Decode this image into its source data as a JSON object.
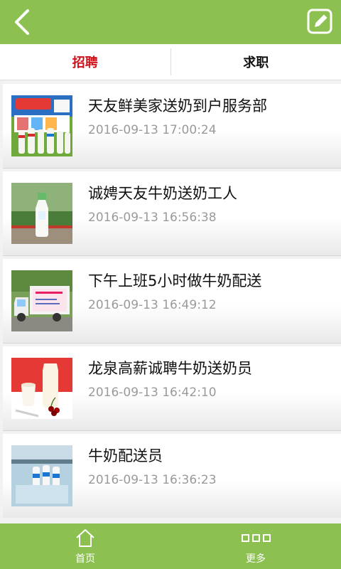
{
  "tabs": [
    {
      "label": "招聘"
    },
    {
      "label": "求职"
    }
  ],
  "items": [
    {
      "title": "天友鲜美家送奶到户服务部",
      "time": "2016-09-13 17:00:24",
      "thumb": "milk-products-photo"
    },
    {
      "title": "诚娉天友牛奶送奶工人",
      "time": "2016-09-13 16:56:38",
      "thumb": "milk-bottle-photo"
    },
    {
      "title": "下午上班5小时做牛奶配送",
      "time": "2016-09-13 16:49:12",
      "thumb": "delivery-truck-photo"
    },
    {
      "title": "龙泉高薪诚聘牛奶送奶员",
      "time": "2016-09-13 16:42:10",
      "thumb": "yogurt-cherries-photo"
    },
    {
      "title": "牛奶配送员",
      "time": "2016-09-13 16:36:23",
      "thumb": "milk-fridge-photo"
    }
  ],
  "bottom_nav": [
    {
      "label": "首页",
      "icon": "home-icon"
    },
    {
      "label": "更多",
      "icon": "more-icon"
    }
  ],
  "colors": {
    "accent": "#8cc152",
    "active_tab": "#d0111a"
  }
}
